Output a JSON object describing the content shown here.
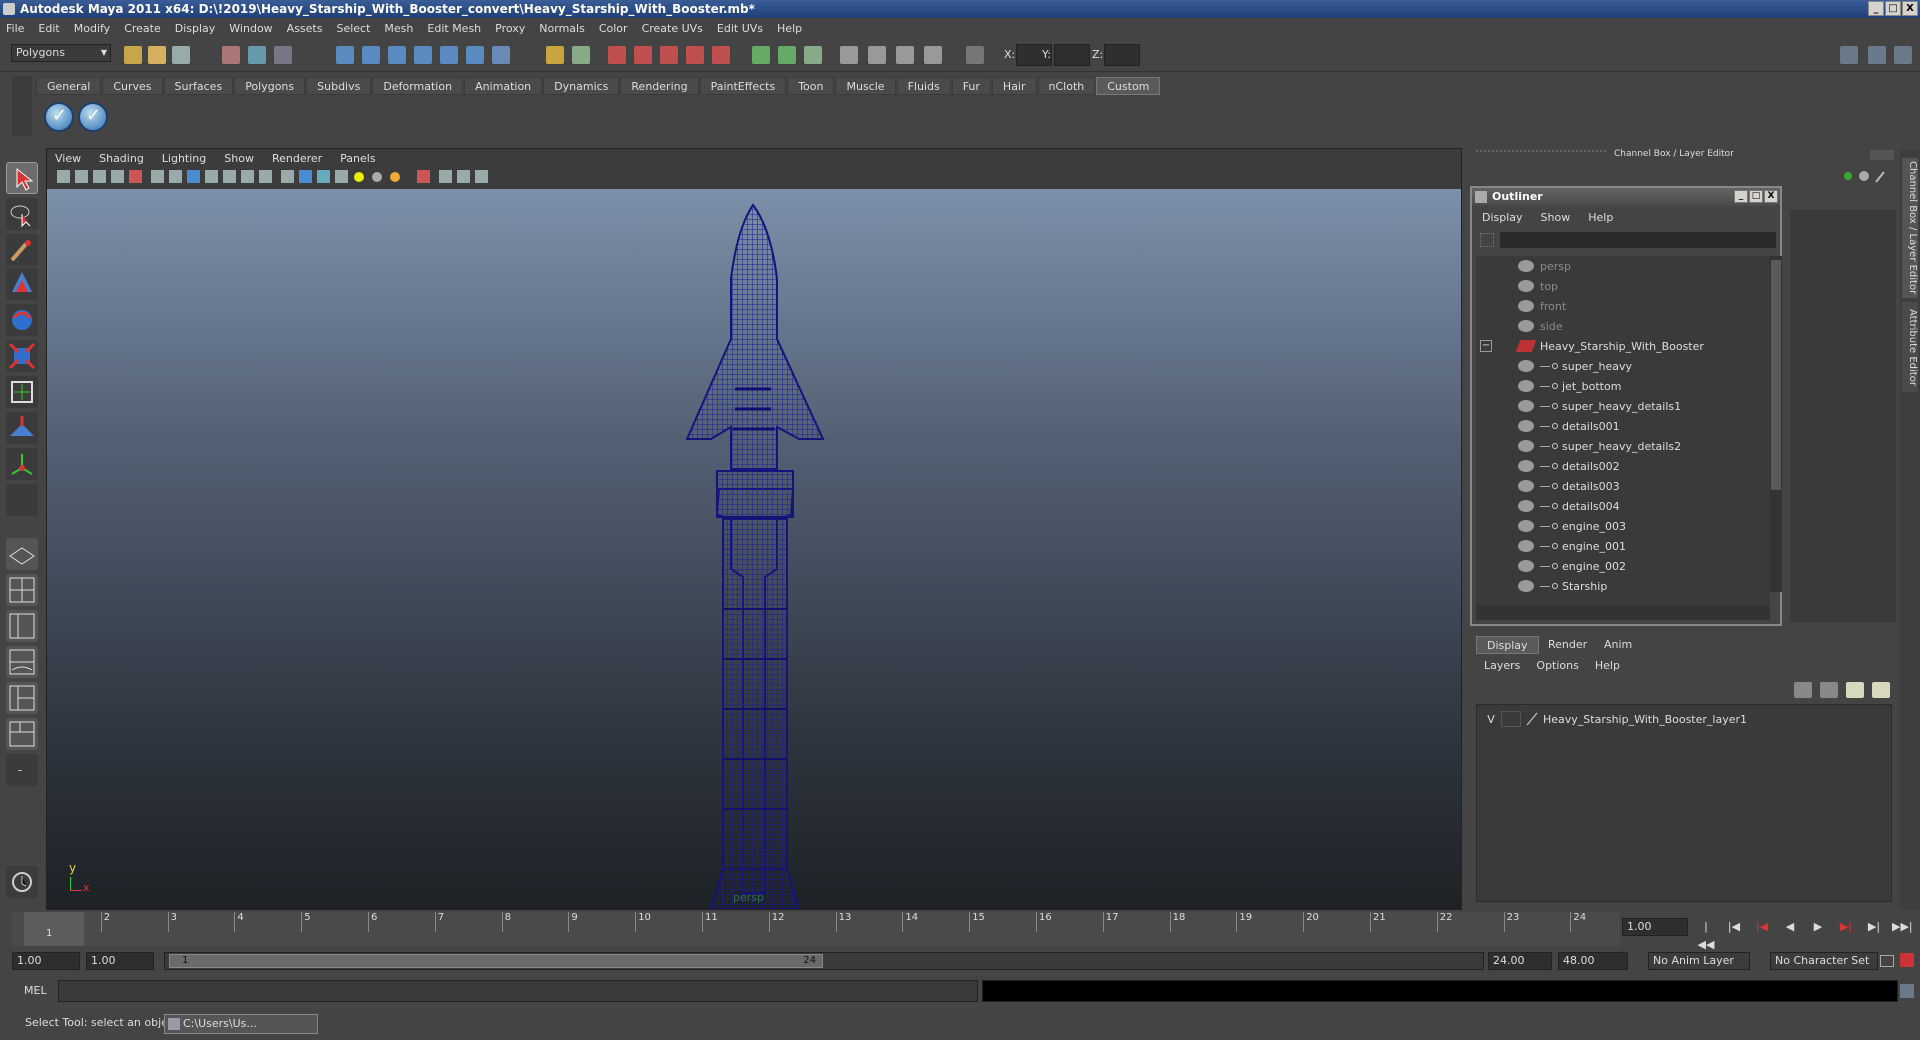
{
  "window": {
    "title": "Autodesk Maya 2011 x64: D:\\!2019\\Heavy_Starship_With_Booster_convert\\Heavy_Starship_With_Booster.mb*",
    "min": "_",
    "max": "□",
    "close": "X"
  },
  "menubar": [
    "File",
    "Edit",
    "Modify",
    "Create",
    "Display",
    "Window",
    "Assets",
    "Select",
    "Mesh",
    "Edit Mesh",
    "Proxy",
    "Normals",
    "Color",
    "Create UVs",
    "Edit UVs",
    "Help"
  ],
  "statusline": {
    "mode": "Polygons",
    "x_label": "X:",
    "y_label": "Y:",
    "z_label": "Z:"
  },
  "shelf": {
    "tabs": [
      "General",
      "Curves",
      "Surfaces",
      "Polygons",
      "Subdivs",
      "Deformation",
      "Animation",
      "Dynamics",
      "Rendering",
      "PaintEffects",
      "Toon",
      "Muscle",
      "Fluids",
      "Fur",
      "Hair",
      "nCloth",
      "Custom"
    ],
    "active_tab": "Custom"
  },
  "viewport": {
    "menu": [
      "View",
      "Shading",
      "Lighting",
      "Show",
      "Renderer",
      "Panels"
    ],
    "camera_label": "persp",
    "axis_y": "y",
    "axis_x": "x"
  },
  "channel_box": {
    "title": "Channel Box / Layer Editor"
  },
  "side_tabs": [
    "Channel Box / Layer Editor",
    "Attribute Editor"
  ],
  "outliner": {
    "title": "Outliner",
    "menu": [
      "Display",
      "Show",
      "Help"
    ],
    "cameras": [
      "persp",
      "top",
      "front",
      "side"
    ],
    "root": "Heavy_Starship_With_Booster",
    "collapse_glyph": "−",
    "children": [
      "super_heavy",
      "jet_bottom",
      "super_heavy_details1",
      "details001",
      "super_heavy_details2",
      "details002",
      "details003",
      "details004",
      "engine_003",
      "engine_001",
      "engine_002",
      "Starship"
    ]
  },
  "layer_editor": {
    "tabs": [
      "Display",
      "Render",
      "Anim"
    ],
    "active_tab": "Display",
    "menu": [
      "Layers",
      "Options",
      "Help"
    ],
    "layer": {
      "visible": "V",
      "name": "Heavy_Starship_With_Booster_layer1"
    }
  },
  "timeline": {
    "frames": [
      "1",
      "2",
      "3",
      "4",
      "5",
      "6",
      "7",
      "8",
      "9",
      "10",
      "11",
      "12",
      "13",
      "14",
      "15",
      "16",
      "17",
      "18",
      "19",
      "20",
      "21",
      "22",
      "23",
      "24"
    ],
    "current_frame_marker": "1",
    "current_time": "1.00"
  },
  "range": {
    "start": "1.00",
    "playback_start": "1.00",
    "slider_start": "1",
    "slider_end": "24",
    "playback_end": "24.00",
    "end": "48.00",
    "anim_layer": "No Anim Layer",
    "character_set": "No Character Set"
  },
  "command_line": {
    "label": "MEL"
  },
  "help_line": {
    "text": "Select Tool: select an object",
    "task": "C:\\Users\\Us..."
  },
  "colors": {
    "wireframe": "#1a1a8a",
    "bg_top": "#7c90a9",
    "bg_bottom": "#1e2226",
    "title_bar": "#2a4c8a"
  }
}
